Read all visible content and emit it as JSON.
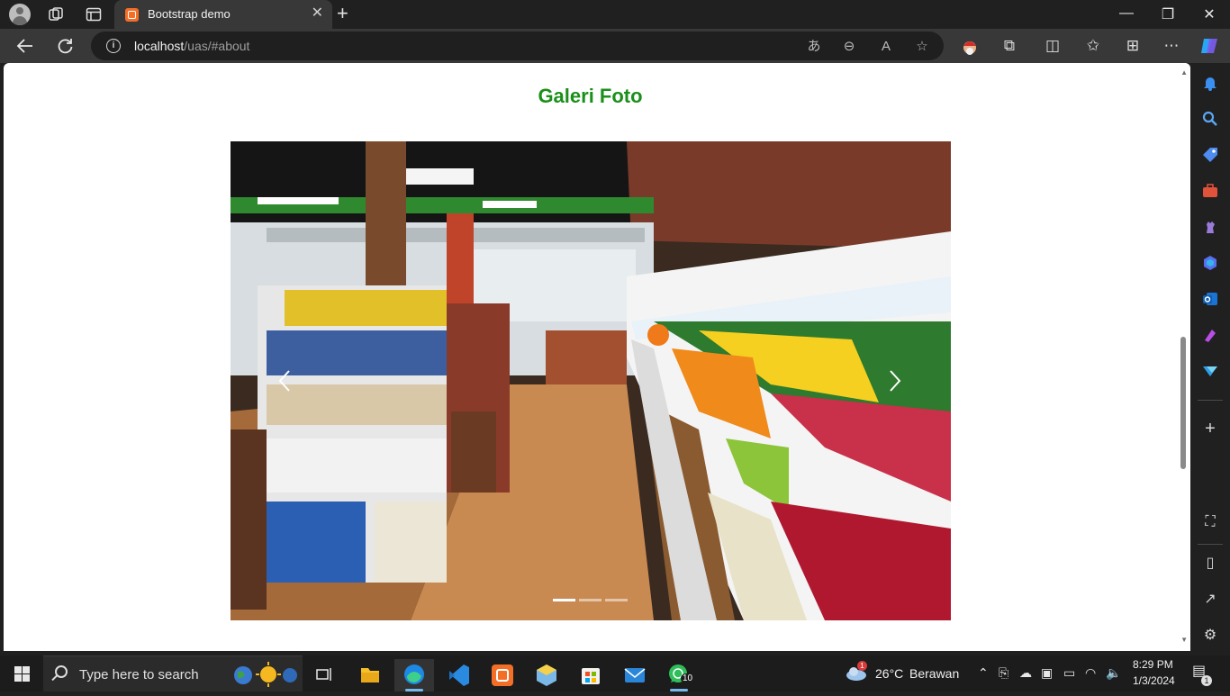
{
  "browser": {
    "tab_title": "Bootstrap demo",
    "url_host": "localhost",
    "url_path": "/uas/#about",
    "close_tab": "✕",
    "new_tab": "+",
    "window_controls": {
      "minimize": "—",
      "restore": "❐",
      "close": "✕"
    }
  },
  "page": {
    "gallery_title": "Galeri Foto",
    "carousel": {
      "slide_description": "Supermarket interior with fruit shelves",
      "prev_label": "‹",
      "next_label": "›",
      "indicator_count": 3,
      "active_indicator": 0
    }
  },
  "taskbar": {
    "search_placeholder": "Type here to search",
    "weather_temp": "26°C",
    "weather_desc": "Berawan",
    "weather_badge": "1",
    "time": "8:29 PM",
    "date": "1/3/2024",
    "whatsapp_badge": "10",
    "notification_badge": "1"
  },
  "colors": {
    "accent_green": "#1a8f1a",
    "xampp_orange": "#f36f28",
    "edge_blue": "#1e88e5"
  }
}
